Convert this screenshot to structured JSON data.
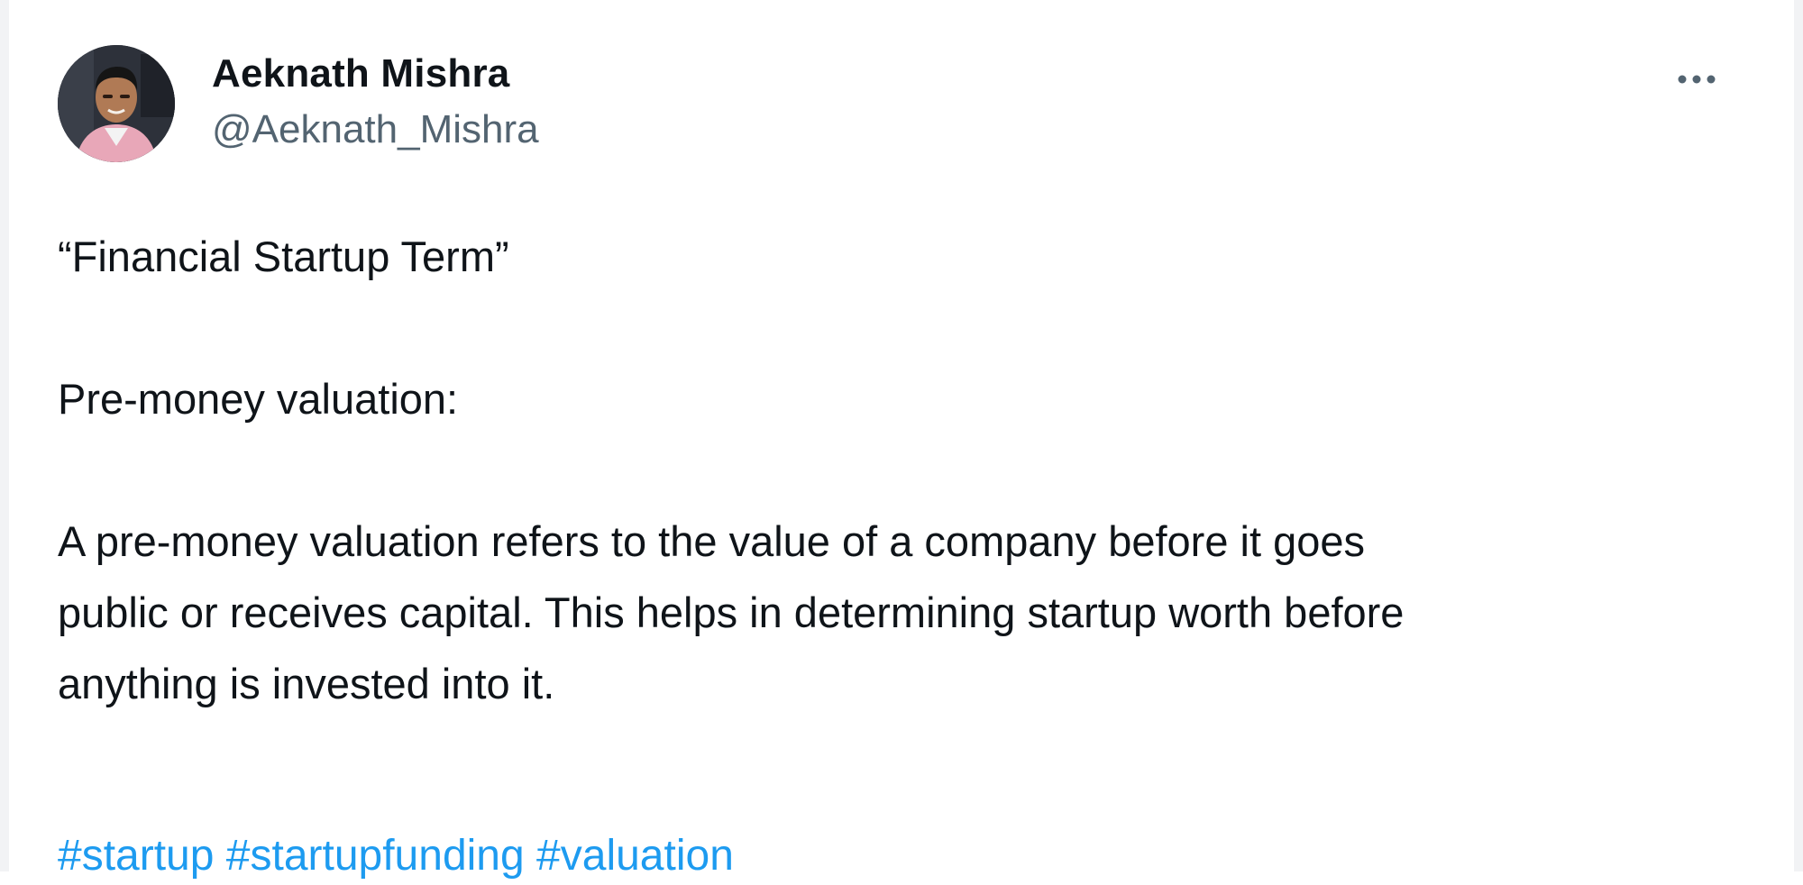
{
  "author": {
    "display_name": "Aeknath Mishra",
    "handle": "@Aeknath_Mishra",
    "avatar_icon": "profile-photo"
  },
  "more_menu": {
    "icon": "ellipsis-icon",
    "label": "•••"
  },
  "post": {
    "title_line": "“Financial Startup Term”",
    "heading": "Pre-money valuation:",
    "paragraph_line1": "A pre-money valuation refers to the value of a company before it goes",
    "paragraph_line2": "public or receives capital. This helps in determining startup worth before",
    "paragraph_line3": "anything is invested into it.",
    "hashtags": [
      "#startup",
      "#startupfunding",
      "#valuation"
    ]
  },
  "colors": {
    "text_primary": "#0f1419",
    "text_secondary": "#536471",
    "link": "#1d9bf0",
    "background": "#ffffff"
  }
}
